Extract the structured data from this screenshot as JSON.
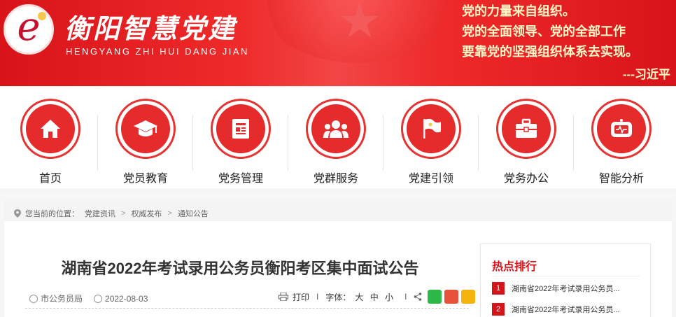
{
  "header": {
    "logo_title": "衡阳智慧党建",
    "logo_subtitle": "HENGYANG ZHI HUI DANG JIAN",
    "quote_lines": [
      "党的力量来自组织。",
      "党的全面领导、党的全部工作",
      "要靠党的坚强组织体系去实现。"
    ],
    "quote_author": "---习近平"
  },
  "nav": {
    "items": [
      {
        "label": "首页",
        "icon": "home-icon"
      },
      {
        "label": "党员教育",
        "icon": "graduation-cap-icon"
      },
      {
        "label": "党务管理",
        "icon": "document-icon"
      },
      {
        "label": "党群服务",
        "icon": "people-icon"
      },
      {
        "label": "党建引领",
        "icon": "party-flag-icon"
      },
      {
        "label": "党务办公",
        "icon": "briefcase-icon"
      },
      {
        "label": "智能分析",
        "icon": "monitor-icon"
      }
    ]
  },
  "breadcrumb": {
    "prefix": "您当前的位置：",
    "items": [
      "党建资讯",
      "权威发布",
      "通知公告"
    ],
    "separator": ">"
  },
  "article": {
    "title": "湖南省2022年考试录用公务员衡阳考区集中面试公告",
    "source": "市公务员局",
    "date": "2022-08-03",
    "print_label": "打印",
    "font_label": "字体：",
    "font_sizes": [
      "大",
      "中",
      "小"
    ],
    "separator": "I"
  },
  "hot": {
    "title": "热点排行",
    "items": [
      {
        "rank": "1",
        "text": "湖南省2022年考试录用公务员..."
      },
      {
        "rank": "2",
        "text": "湖南省2022年考试录用公务员..."
      }
    ]
  }
}
